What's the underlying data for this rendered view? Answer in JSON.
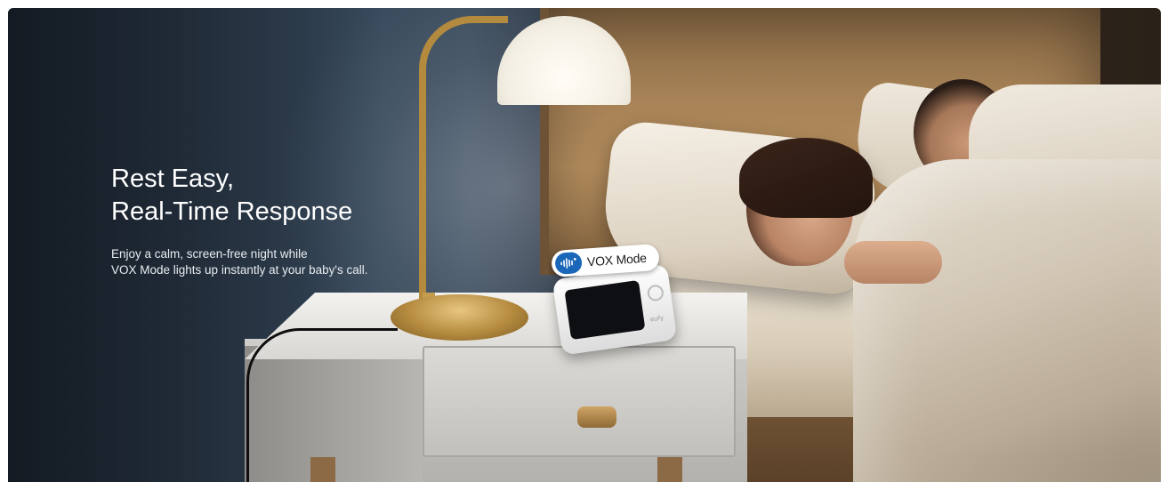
{
  "hero": {
    "headline_lines": [
      "Rest Easy,",
      "Real-Time Response"
    ],
    "subtext_lines": [
      "Enjoy a calm, screen-free night while",
      "VOX Mode lights up instantly at your baby's call."
    ]
  },
  "badge": {
    "label": "VOX Mode",
    "icon": "sound-wave-icon",
    "icon_color": "#1a66b8"
  },
  "device": {
    "logo": "eufy",
    "icon": "baby-monitor-icon"
  },
  "colors": {
    "headline": "#ffffff",
    "badge_bg": "#ffffff"
  }
}
